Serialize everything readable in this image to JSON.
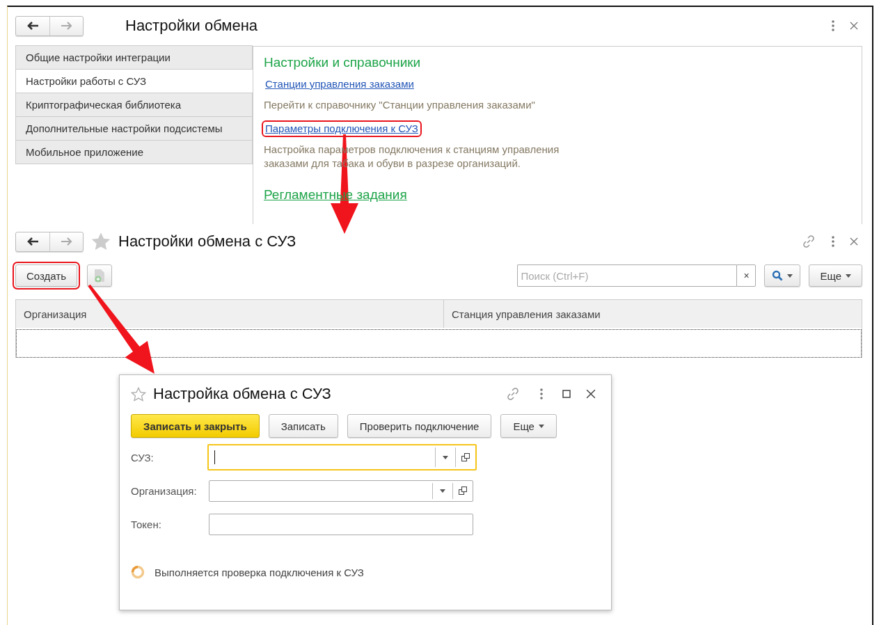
{
  "settings_window": {
    "title": "Настройки обмена",
    "tabs": [
      {
        "label": "Общие настройки интеграции",
        "selected": false
      },
      {
        "label": "Настройки работы с СУЗ",
        "selected": true
      },
      {
        "label": "Криптографическая библиотека",
        "selected": false
      },
      {
        "label": "Дополнительные настройки подсистемы",
        "selected": false
      },
      {
        "label": "Мобильное приложение",
        "selected": false
      }
    ],
    "panel": [
      {
        "kind": "heading",
        "text": "Настройки и справочники"
      },
      {
        "kind": "link",
        "text": "Станции управления заказами",
        "highlighted": false
      },
      {
        "kind": "description",
        "text": "Перейти к справочнику \"Станции управления заказами\""
      },
      {
        "kind": "link",
        "text": "Параметры подключения к СУЗ",
        "highlighted": true
      },
      {
        "kind": "description",
        "text": "Настройка параметров подключения к станциям управления заказами для табака и обуви в разрезе организаций."
      },
      {
        "kind": "group-link",
        "text": "Регламентные задания"
      }
    ]
  },
  "list_window": {
    "title": "Настройки обмена с СУЗ",
    "create_button": {
      "label": "Создать",
      "highlighted": true
    },
    "search": {
      "placeholder": "Поиск (Ctrl+F)",
      "clear": "×"
    },
    "more_button": "Еще",
    "table": {
      "columns": [
        "Организация",
        "Станция управления заказами"
      ],
      "rows": [
        {
          "selected": true
        }
      ]
    }
  },
  "dialog": {
    "title": "Настройка обмена с СУЗ",
    "buttons": [
      {
        "label": "Записать и закрыть",
        "kind": "primary"
      },
      {
        "label": "Записать",
        "kind": "normal"
      },
      {
        "label": "Проверить подключение",
        "kind": "normal"
      },
      {
        "label": "Еще",
        "kind": "menu"
      }
    ],
    "fields": [
      {
        "label": "СУЗ:",
        "kind": "select",
        "focused": true
      },
      {
        "label": "Организация:",
        "kind": "select",
        "focused": false
      },
      {
        "label": "Токен:",
        "kind": "text",
        "focused": false
      }
    ],
    "status": "Выполняется проверка подключения к СУЗ"
  }
}
